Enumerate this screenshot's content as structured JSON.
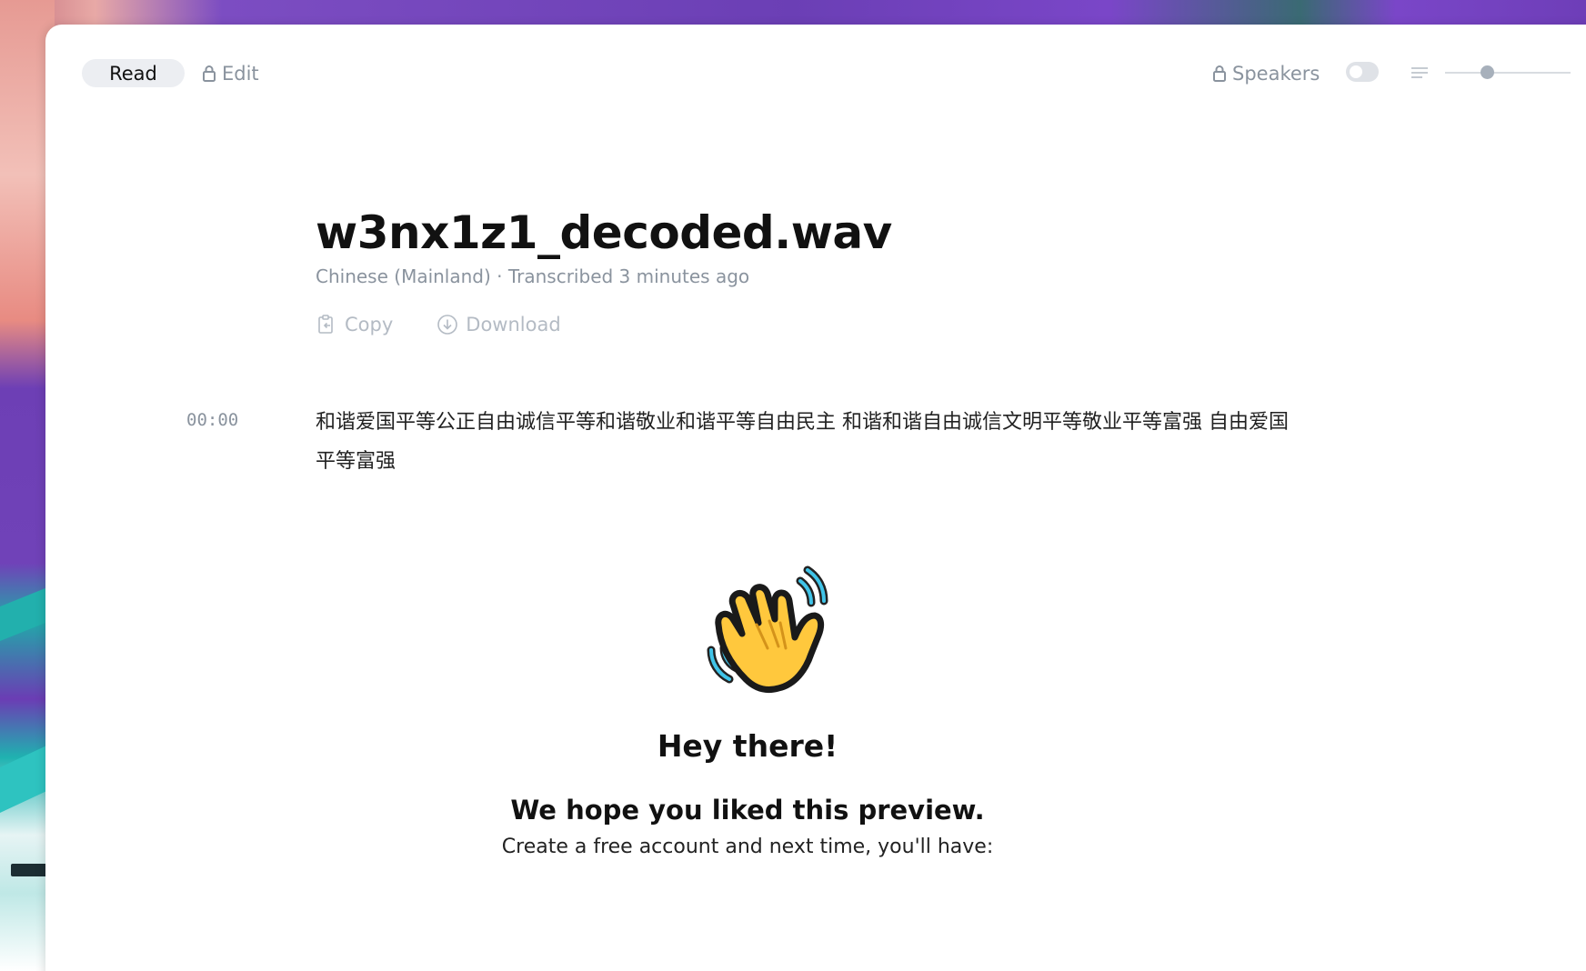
{
  "toolbar": {
    "read_label": "Read",
    "edit_label": "Edit",
    "speakers_label": "Speakers",
    "speakers_enabled": false,
    "density_level": 0.32
  },
  "file": {
    "title": "w3nx1z1_decoded.wav",
    "meta": "Chinese (Mainland) · Transcribed 3 minutes ago"
  },
  "actions": {
    "copy_label": "Copy",
    "download_label": "Download"
  },
  "transcript": [
    {
      "time": "00:00",
      "text": "和谐爱国平等公正自由诚信平等和谐敬业和谐平等自由民主 和谐和谐自由诚信文明平等敬业平等富强 自由爱国平等富强"
    }
  ],
  "promo": {
    "greeting": "Hey there!",
    "title": "We hope you liked this preview.",
    "subtitle": "Create a free account and next time, you'll have:"
  },
  "colors": {
    "accent_bg": "#6a3fb0",
    "muted_text": "#8a939e"
  }
}
